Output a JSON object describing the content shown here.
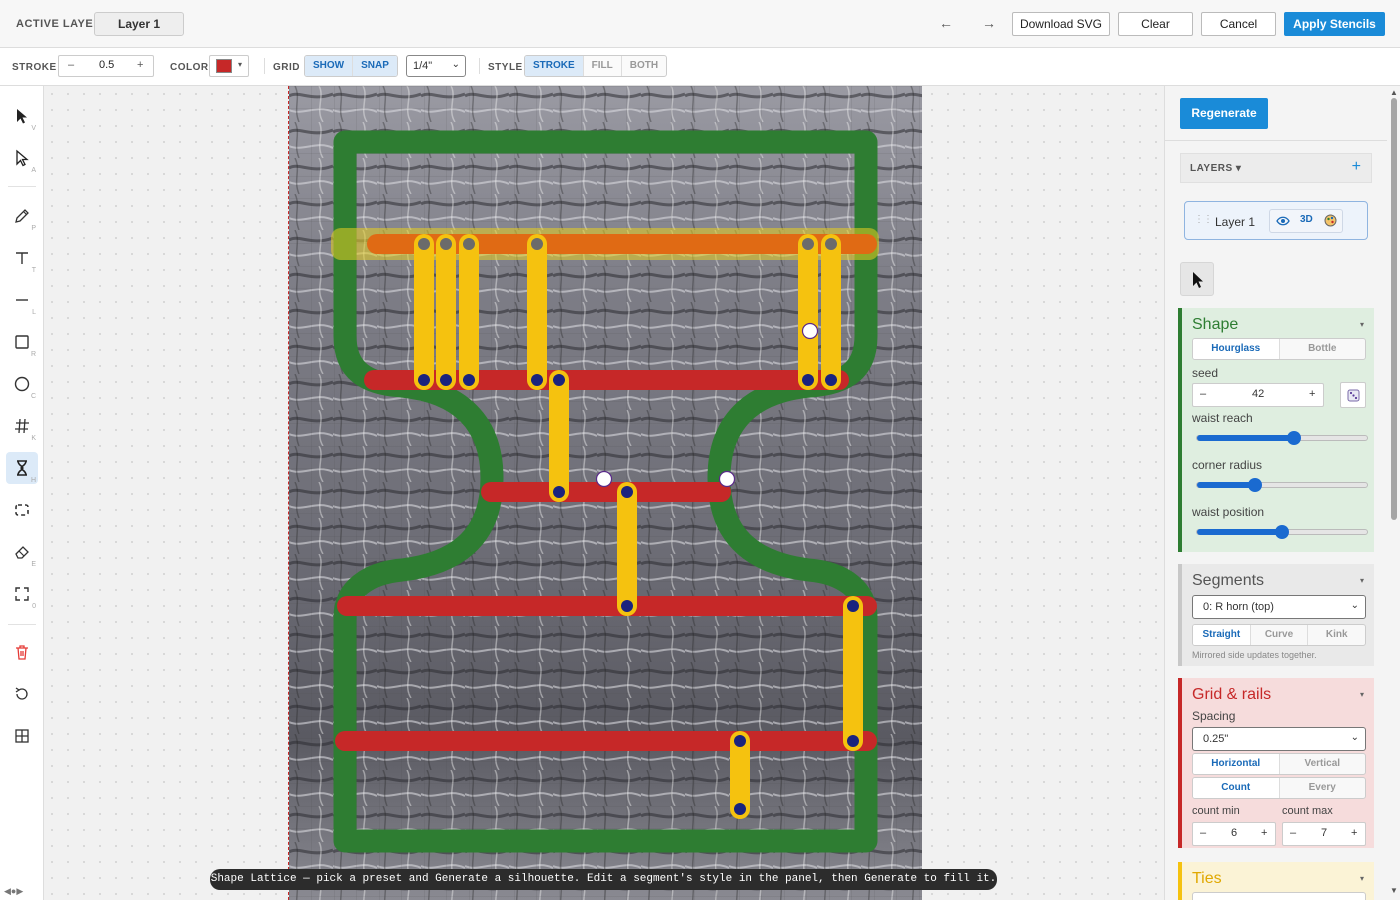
{
  "topbar": {
    "active_layer_label": "ACTIVE LAYER",
    "layer_name": "Layer 1",
    "undo_glyph": "←",
    "redo_glyph": "→",
    "download_label": "Download SVG",
    "clear_label": "Clear",
    "cancel_label": "Cancel",
    "apply_label": "Apply Stencils"
  },
  "toolbar": {
    "stroke_label": "STROKE",
    "stroke_minus": "–",
    "stroke_value": "0.5",
    "stroke_plus": "+",
    "color_label": "COLOR",
    "color_value": "#c62828",
    "grid_label": "GRID",
    "grid_show": "SHOW",
    "grid_snap": "SNAP",
    "grid_size": "1/4\"",
    "style_label": "STYLE",
    "style_stroke": "STROKE",
    "style_fill": "FILL",
    "style_both": "BOTH"
  },
  "tools": [
    {
      "name": "select-tool",
      "key": "V",
      "icon": "arrow-icon"
    },
    {
      "name": "direct-select-tool",
      "key": "A",
      "icon": "hollow-arrow-icon"
    },
    {
      "name": "pen-tool",
      "key": "P",
      "icon": "pen-icon"
    },
    {
      "name": "text-tool",
      "key": "T",
      "icon": "text-icon"
    },
    {
      "name": "line-tool",
      "key": "L",
      "icon": "line-icon"
    },
    {
      "name": "rectangle-tool",
      "key": "R",
      "icon": "rectangle-icon"
    },
    {
      "name": "circle-tool",
      "key": "C",
      "icon": "circle-icon"
    },
    {
      "name": "grid-tool",
      "key": "K",
      "icon": "hash-icon"
    },
    {
      "name": "hourglass-tool",
      "key": "H",
      "icon": "hourglass-icon"
    },
    {
      "name": "frame-tool",
      "key": "",
      "icon": "frame-icon"
    },
    {
      "name": "eraser-tool",
      "key": "E",
      "icon": "eraser-icon"
    },
    {
      "name": "fit-tool",
      "key": "0",
      "icon": "fullscreen-icon"
    }
  ],
  "left_footer": "◀●▶",
  "status_text": "Shape Lattice — pick a preset and Generate a silhouette. Edit a segment's style in the panel, then Generate to fill it.",
  "panel": {
    "regenerate_label": "Regenerate",
    "layers_title": "LAYERS ▾",
    "layers_add": "+",
    "layer_row_name": "Layer 1",
    "layer_3d": "3D",
    "shape": {
      "title": "Shape",
      "preset_a": "Hourglass",
      "preset_b": "Bottle",
      "seed_label": "seed",
      "seed_minus": "–",
      "seed_value": "42",
      "seed_plus": "+",
      "waist_reach_label": "waist reach",
      "waist_reach": 0.57,
      "corner_radius_label": "corner radius",
      "corner_radius": 0.34,
      "waist_position_label": "waist position",
      "waist_position": 0.5
    },
    "segments": {
      "title": "Segments",
      "selected": "0: R horn (top)",
      "opt_straight": "Straight",
      "opt_curve": "Curve",
      "opt_kink": "Kink",
      "note": "Mirrored side updates together."
    },
    "grid_rails": {
      "title": "Grid & rails",
      "spacing_label": "Spacing",
      "spacing_value": "0.25\"",
      "orient_h": "Horizontal",
      "orient_v": "Vertical",
      "mode_count": "Count",
      "mode_every": "Every",
      "count_min_label": "count min",
      "count_max_label": "count max",
      "minus": "–",
      "plus": "+",
      "count_min": "6",
      "count_max": "7"
    },
    "ties": {
      "title": "Ties"
    }
  },
  "colors": {
    "accent": "#1a8bd8",
    "outline_green": "#2e7d32",
    "rail_red": "#c62828",
    "rail_orange": "#e06a14",
    "tie_yellow": "#f5c20f",
    "node_navy": "#1a237e"
  }
}
